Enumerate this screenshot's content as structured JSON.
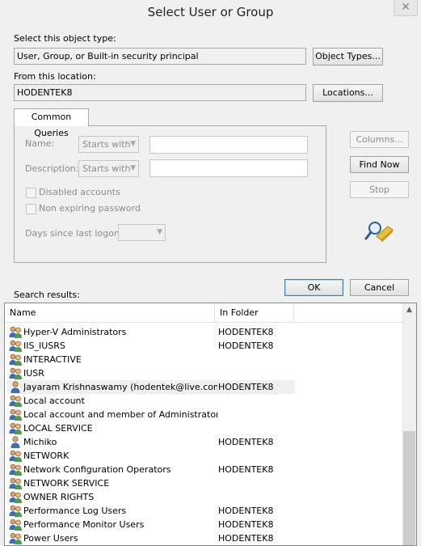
{
  "window": {
    "title": "Select User or Group",
    "close_glyph": "✕"
  },
  "object_type": {
    "label": "Select this object type:",
    "value": "User, Group, or Built-in security principal",
    "button": "Object Types..."
  },
  "location": {
    "label": "From this location:",
    "value": "HODENTEK8",
    "button": "Locations..."
  },
  "common_queries": {
    "tab_label": "Common Queries",
    "name_label": "Name:",
    "name_mode": "Starts with",
    "description_label": "Description:",
    "description_mode": "Starts with",
    "disabled_accounts": "Disabled accounts",
    "non_expiring_password": "Non expiring password",
    "days_since_logon": "Days since last logon:"
  },
  "side_buttons": {
    "columns": "Columns...",
    "find_now": "Find Now",
    "stop": "Stop"
  },
  "dialog_buttons": {
    "ok": "OK",
    "cancel": "Cancel"
  },
  "results": {
    "label": "Search results:",
    "columns": [
      "Name",
      "In Folder"
    ],
    "rows": [
      {
        "name": "Hyper-V Administrators",
        "folder": "HODENTEK8",
        "icon": "group-icon"
      },
      {
        "name": "IIS_IUSRS",
        "folder": "HODENTEK8",
        "icon": "group-icon"
      },
      {
        "name": "INTERACTIVE",
        "folder": "",
        "icon": "group-icon"
      },
      {
        "name": "IUSR",
        "folder": "",
        "icon": "group-icon"
      },
      {
        "name": "Jayaram Krishnaswamy (hodentek@live.com)",
        "folder": "HODENTEK8",
        "icon": "user-icon"
      },
      {
        "name": "Local account",
        "folder": "",
        "icon": "group-icon"
      },
      {
        "name": "Local account and member of Administrators gr...",
        "folder": "",
        "icon": "group-icon"
      },
      {
        "name": "LOCAL SERVICE",
        "folder": "",
        "icon": "group-icon"
      },
      {
        "name": "Michiko",
        "folder": "HODENTEK8",
        "icon": "user-icon"
      },
      {
        "name": "NETWORK",
        "folder": "",
        "icon": "group-icon"
      },
      {
        "name": "Network Configuration Operators",
        "folder": "HODENTEK8",
        "icon": "group-icon"
      },
      {
        "name": "NETWORK SERVICE",
        "folder": "",
        "icon": "group-icon"
      },
      {
        "name": "OWNER RIGHTS",
        "folder": "",
        "icon": "group-icon"
      },
      {
        "name": "Performance Log Users",
        "folder": "HODENTEK8",
        "icon": "group-icon"
      },
      {
        "name": "Performance Monitor Users",
        "folder": "HODENTEK8",
        "icon": "group-icon"
      },
      {
        "name": "Power Users",
        "folder": "HODENTEK8",
        "icon": "group-icon"
      }
    ]
  }
}
